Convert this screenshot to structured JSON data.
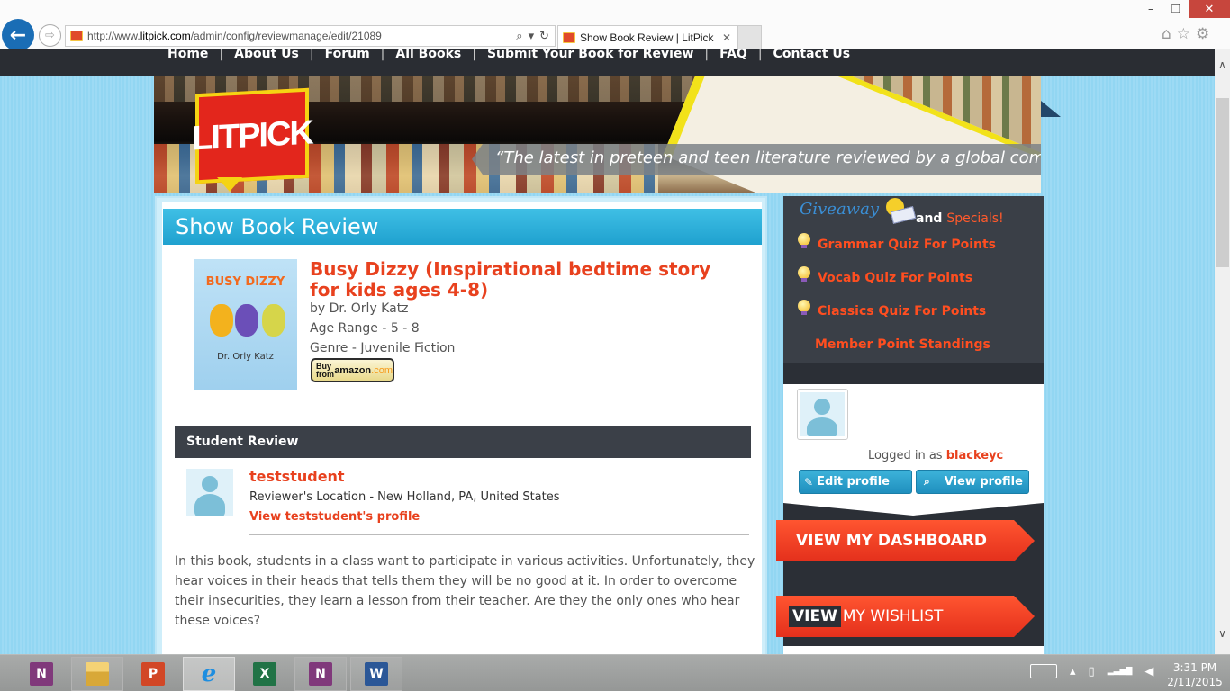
{
  "browser": {
    "url_prefix": "http://www.",
    "url_domain": "litpick.com",
    "url_path": "/admin/config/reviewmanage/edit/21089",
    "tab_title": "Show Book Review | LitPick",
    "window_controls": {
      "minimize": "–",
      "maximize": "❐",
      "close": "✕"
    },
    "icons": {
      "back": "←",
      "forward": "⇨",
      "search": "⌕",
      "dropdown": "▾",
      "refresh": "↻",
      "tab_close": "✕",
      "home": "⌂",
      "favorites": "☆",
      "settings": "⚙"
    }
  },
  "site_nav": {
    "items": [
      "Home",
      "About Us",
      "Forum",
      "All Books",
      "Submit Your Book for Review",
      "FAQ",
      "Contact Us"
    ],
    "separator": "|"
  },
  "banner": {
    "logo_text": "LITPICK",
    "tagline": "“The latest in preteen and teen literature reviewed by a global community of students”"
  },
  "main": {
    "page_title": "Show Book Review",
    "book": {
      "cover_title": "BUSY DIZZY",
      "cover_author": "Dr. Orly Katz",
      "title": "Busy Dizzy (Inspirational bedtime story for kids ages 4-8)",
      "author": "by Dr. Orly Katz",
      "age_range": "Age Range - 5 - 8",
      "genre": "Genre - Juvenile Fiction",
      "buy_button": {
        "buy": "Buy from",
        "store": "amazon",
        "suffix": ".com"
      }
    },
    "review": {
      "section_title": "Student Review",
      "reviewer_name": "teststudent",
      "reviewer_location": "Reviewer's Location - New Holland, PA, United States",
      "profile_link": "View teststudent's profile",
      "body": "In this book, students in a class want to participate in various activities. Unfortunately, they hear voices in their heads that tells them they will be no good at it. In order to overcome their insecurities, they learn a lesson from their teacher. Are they the only ones who hear these voices?"
    }
  },
  "sidebar": {
    "giveaway_label": "Giveaway",
    "and_label": "and",
    "specials_label": "Specials!",
    "links": [
      {
        "label": "Grammar Quiz For Points",
        "bulb": true
      },
      {
        "label": "Vocab Quiz For Points",
        "bulb": true
      },
      {
        "label": "Classics Quiz For Points",
        "bulb": true
      },
      {
        "label": "Member Point Standings",
        "bulb": false
      }
    ],
    "profile": {
      "logged_in_prefix": "Logged in as",
      "username": "blackeyc",
      "edit_button": "Edit profile",
      "view_button": "View profile",
      "edit_icon": "✎",
      "view_icon": "⌕"
    },
    "dashboard_button": "VIEW MY DASHBOARD",
    "wishlist_button": {
      "highlight": "VIEW",
      "rest": "MY WISHLIST"
    }
  },
  "scrollbar": {
    "up": "∧",
    "down": "∨",
    "position_fraction": 0.0
  },
  "taskbar": {
    "apps": [
      {
        "name": "OneNote",
        "glyph": "N"
      },
      {
        "name": "File Explorer",
        "glyph": ""
      },
      {
        "name": "PowerPoint",
        "glyph": "P"
      },
      {
        "name": "Internet Explorer",
        "glyph": "e"
      },
      {
        "name": "Excel",
        "glyph": "X"
      },
      {
        "name": "OneNote Clipper",
        "glyph": "N"
      },
      {
        "name": "Word",
        "glyph": "W"
      }
    ],
    "tray": {
      "show_hidden": "▴",
      "battery": "▯",
      "signal": "▂▃▅▇",
      "volume": "◀"
    },
    "time": "3:31 PM",
    "date": "2/11/2015"
  }
}
